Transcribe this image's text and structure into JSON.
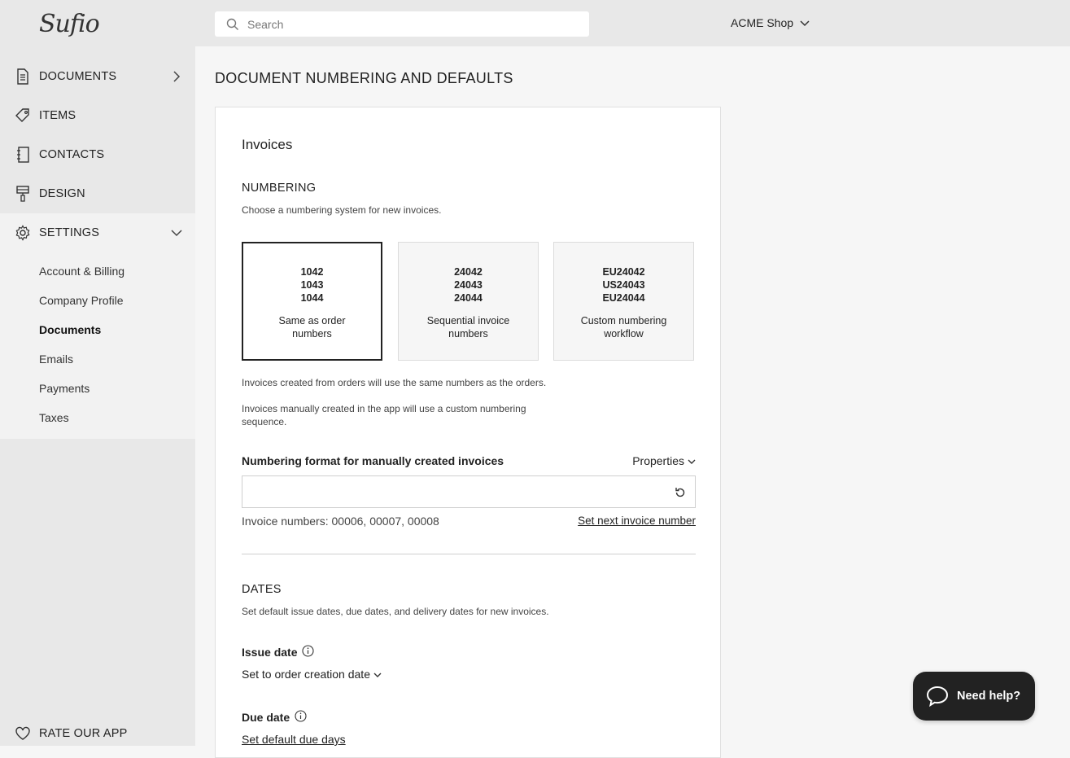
{
  "app": {
    "logo": "Sufio"
  },
  "sidebar": {
    "items": [
      {
        "label": "DOCUMENTS",
        "icon": "document-icon"
      },
      {
        "label": "ITEMS",
        "icon": "tag-icon"
      },
      {
        "label": "CONTACTS",
        "icon": "contacts-book-icon"
      },
      {
        "label": "DESIGN",
        "icon": "paint-brush-icon"
      },
      {
        "label": "SETTINGS",
        "icon": "gear-icon"
      }
    ],
    "settings_sub": [
      "Account & Billing",
      "Company Profile",
      "Documents",
      "Emails",
      "Payments",
      "Taxes"
    ],
    "active_sub": "Documents",
    "rate": "RATE OUR APP"
  },
  "topbar": {
    "search_placeholder": "Search",
    "shop": "ACME Shop"
  },
  "page": {
    "title": "DOCUMENT NUMBERING AND DEFAULTS",
    "card_title": "Invoices",
    "numbering": {
      "heading": "NUMBERING",
      "desc": "Choose a numbering system for new invoices.",
      "options": [
        {
          "nums": [
            "1042",
            "1043",
            "1044"
          ],
          "name": "Same as order numbers",
          "selected": true
        },
        {
          "nums": [
            "24042",
            "24043",
            "24044"
          ],
          "name": "Sequential invoice numbers",
          "selected": false
        },
        {
          "nums": [
            "EU24042",
            "US24043",
            "EU24044"
          ],
          "name": "Custom numbering workflow",
          "selected": false
        }
      ],
      "note1": "Invoices created from orders will use the same numbers as the orders.",
      "note2": "Invoices manually created in the app will use a custom numbering sequence.",
      "format_label": "Numbering format for manually created invoices",
      "properties": "Properties",
      "format_value": "",
      "invoice_numbers": "Invoice numbers: 00006, 00007, 00008",
      "set_next": "Set next invoice number"
    },
    "dates": {
      "heading": "DATES",
      "desc": "Set default issue dates, due dates, and delivery dates for new invoices.",
      "issue_label": "Issue date",
      "issue_value": "Set to order creation date",
      "due_label": "Due date",
      "due_link": "Set default due days"
    }
  },
  "help": {
    "label": "Need help?"
  }
}
